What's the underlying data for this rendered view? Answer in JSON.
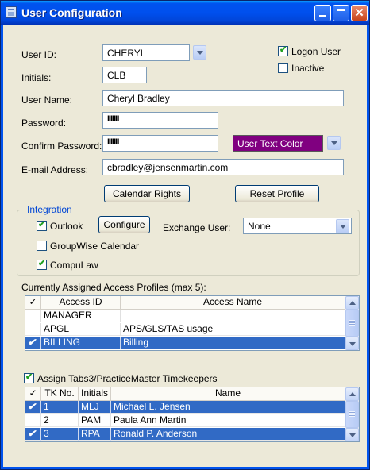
{
  "window": {
    "title": "User Configuration"
  },
  "form": {
    "user_id_label": "User ID:",
    "user_id_value": "CHERYL",
    "initials_label": "Initials:",
    "initials_value": "CLB",
    "user_name_label": "User Name:",
    "user_name_value": "Cheryl Bradley",
    "password_label": "Password:",
    "password_value": "IIIIIII",
    "confirm_password_label": "Confirm Password:",
    "confirm_password_value": "IIIIIII",
    "email_label": "E-mail Address:",
    "email_value": "cbradley@jensenmartin.com",
    "logon_user_label": "Logon User",
    "logon_user_checked": true,
    "inactive_label": "Inactive",
    "inactive_checked": false,
    "user_text_color_label": "User Text Color",
    "user_text_color_swatch": "#800080"
  },
  "buttons": {
    "calendar_rights": "Calendar Rights",
    "reset_profile": "Reset Profile",
    "configure": "Configure"
  },
  "integration": {
    "title": "Integration",
    "outlook_label": "Outlook",
    "outlook_checked": true,
    "groupwise_label": "GroupWise Calendar",
    "groupwise_checked": false,
    "compulaw_label": "CompuLaw",
    "compulaw_checked": true,
    "exchange_user_label": "Exchange User:",
    "exchange_user_value": "None"
  },
  "access_profiles": {
    "label": "Currently Assigned Access Profiles (max 5):",
    "columns": [
      "✓",
      "Access ID",
      "Access Name"
    ],
    "rows": [
      {
        "check": "",
        "id": "MANAGER",
        "name": "",
        "selected": false
      },
      {
        "check": "",
        "id": "APGL",
        "name": "APS/GLS/TAS usage",
        "selected": false
      },
      {
        "check": "✔",
        "id": "BILLING",
        "name": "Billing",
        "selected": true
      }
    ]
  },
  "timekeepers": {
    "assign_label": "Assign Tabs3/PracticeMaster Timekeepers",
    "assign_checked": true,
    "columns": [
      "✓",
      "TK No.",
      "Initials",
      "Name"
    ],
    "rows": [
      {
        "check": "✔",
        "tk": "1",
        "initials": "MLJ",
        "name": "Michael L. Jensen",
        "selected": true
      },
      {
        "check": "",
        "tk": "2",
        "initials": "PAM",
        "name": "Paula Ann Martin",
        "selected": false
      },
      {
        "check": "✔",
        "tk": "3",
        "initials": "RPA",
        "name": "Ronald P. Anderson",
        "selected": true
      }
    ]
  },
  "colors": {
    "title_bar": "#0053ee",
    "selection": "#316ac5",
    "group_title": "#0046d5"
  }
}
